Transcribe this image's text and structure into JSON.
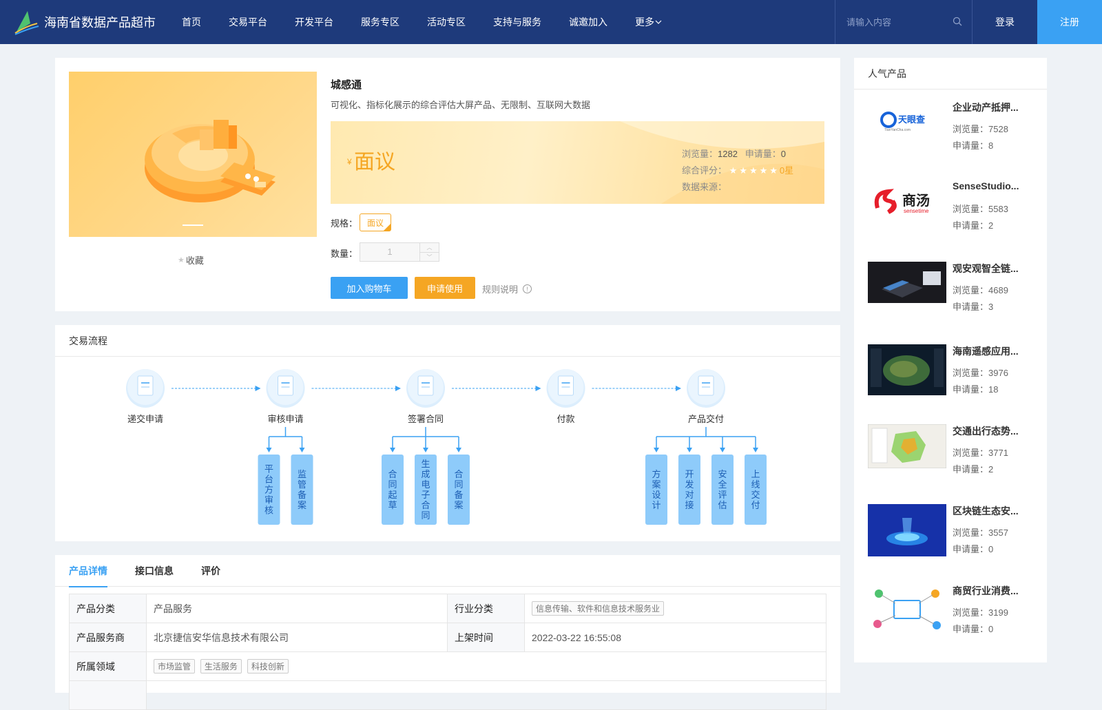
{
  "header": {
    "site_title": "海南省数据产品超市",
    "nav": [
      "首页",
      "交易平台",
      "开发平台",
      "服务专区",
      "活动专区",
      "支持与服务",
      "诚邀加入"
    ],
    "more_label": "更多",
    "search_placeholder": "请输入内容",
    "login_label": "登录",
    "register_label": "注册"
  },
  "product": {
    "name": "城感通",
    "description": "可视化、指标化展示的综合评估大屏产品、无限制、互联网大数据",
    "currency_symbol": "¥",
    "price_label": "面议",
    "views_label": "浏览量：",
    "views": "1282",
    "applications_label": "申请量：",
    "applications": "0",
    "rating_label": "综合评分：",
    "rating_text": "0星",
    "rating_value": 0,
    "source_label": "数据来源：",
    "spec_label": "规格：",
    "spec_option": "面议",
    "qty_label": "数量：",
    "qty_value": "1",
    "add_to_cart": "加入购物车",
    "apply": "申请使用",
    "rules": "规则说明",
    "favorite": "收藏",
    "accent_color": "#f5a623"
  },
  "flow": {
    "title": "交易流程",
    "steps": [
      {
        "label": "递交申请",
        "subs": []
      },
      {
        "label": "审核申请",
        "subs": [
          "平台方审核",
          "监管备案"
        ]
      },
      {
        "label": "签署合同",
        "subs": [
          "合同起草",
          "生成电子合同",
          "合同备案"
        ]
      },
      {
        "label": "付款",
        "subs": []
      },
      {
        "label": "产品交付",
        "subs": [
          "方案设计",
          "开发对接",
          "安全评估",
          "上线交付"
        ]
      }
    ]
  },
  "detail": {
    "tabs": [
      "产品详情",
      "接口信息",
      "评价"
    ],
    "active_tab": 0,
    "rows": {
      "category_key": "产品分类",
      "category_val": "产品服务",
      "industry_key": "行业分类",
      "industry_tag": "信息传输、软件和信息技术服务业",
      "provider_key": "产品服务商",
      "provider_val": "北京捷信安华信息技术有限公司",
      "listed_key": "上架时间",
      "listed_val": "2022-03-22 16:55:08",
      "domain_key": "所属领域",
      "domain_tags": [
        "市场监管",
        "生活服务",
        "科技创新"
      ]
    }
  },
  "popular": {
    "title": "人气产品",
    "views_label": "浏览量：",
    "applications_label": "申请量：",
    "items": [
      {
        "name": "企业动产抵押...",
        "views": "7528",
        "applications": "8",
        "thumb": "tianyancha-logo"
      },
      {
        "name": "SenseStudio...",
        "views": "5583",
        "applications": "2",
        "thumb": "sensetime-logo"
      },
      {
        "name": "观安观智全链...",
        "views": "4689",
        "applications": "3",
        "thumb": "device-photo"
      },
      {
        "name": "海南遥感应用...",
        "views": "3976",
        "applications": "18",
        "thumb": "satellite-map"
      },
      {
        "name": "交通出行态势...",
        "views": "3771",
        "applications": "2",
        "thumb": "region-map"
      },
      {
        "name": "区块链生态安...",
        "views": "3557",
        "applications": "0",
        "thumb": "blockchain-art"
      },
      {
        "name": "商贸行业消费...",
        "views": "3199",
        "applications": "0",
        "thumb": "network-diagram"
      }
    ]
  }
}
